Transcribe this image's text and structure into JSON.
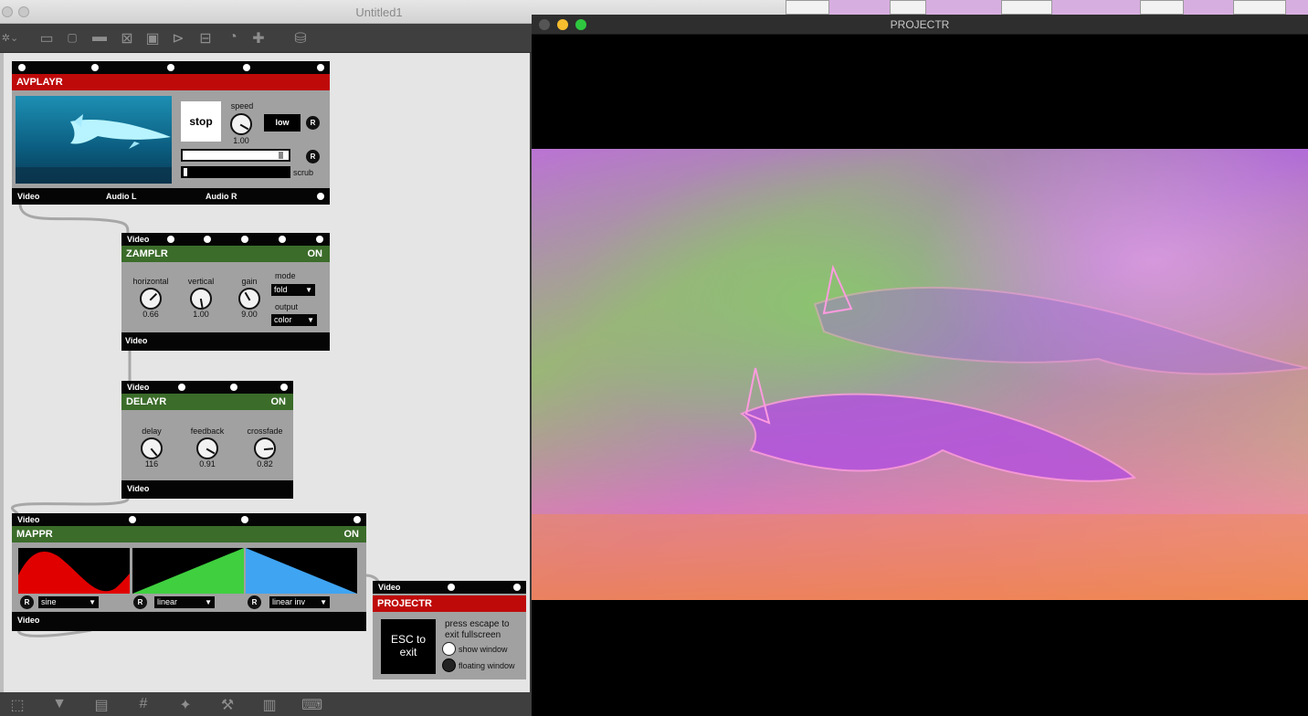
{
  "max_window": {
    "title": "Untitled1",
    "toolbar_icons": [
      "presentation-icon",
      "comment-icon",
      "message-icon",
      "toggle-icon",
      "number-icon",
      "play-icon",
      "slider-icon",
      "dial-icon",
      "add-icon",
      "paint-bucket-icon"
    ],
    "bottombar_icons": [
      "select-icon",
      "presentation-mode-icon",
      "layers-icon",
      "grid-icon",
      "snap-icon",
      "wrench-icon",
      "piano-icon",
      "keyboard-icon"
    ]
  },
  "avplayr": {
    "title": "AVPLAYR",
    "stop_label": "stop",
    "speed_label": "speed",
    "speed_value": "1.00",
    "quality_label": "low",
    "reset_label": "R",
    "scrub_label": "scrub",
    "outputs": [
      "Video",
      "Audio L",
      "Audio R"
    ]
  },
  "zamplr": {
    "input_label": "Video",
    "title": "ZAMPLR",
    "on_label": "ON",
    "knobs": [
      {
        "label": "horizontal",
        "value": "0.66"
      },
      {
        "label": "vertical",
        "value": "1.00"
      },
      {
        "label": "gain",
        "value": "9.00"
      }
    ],
    "mode_label": "mode",
    "mode_value": "fold",
    "output_label": "output",
    "output_value": "color",
    "output_port": "Video"
  },
  "delayr": {
    "input_label": "Video",
    "title": "DELAYR",
    "on_label": "ON",
    "knobs": [
      {
        "label": "delay",
        "value": "116"
      },
      {
        "label": "feedback",
        "value": "0.91"
      },
      {
        "label": "crossfade",
        "value": "0.82"
      }
    ],
    "output_port": "Video"
  },
  "mappr": {
    "input_label": "Video",
    "title": "MAPPR",
    "on_label": "ON",
    "curves": [
      {
        "name": "sine",
        "color": "#e10000"
      },
      {
        "name": "linear",
        "color": "#3fcf3f"
      },
      {
        "name": "linear inv",
        "color": "#3fa4f2"
      }
    ],
    "reset_label": "R",
    "output_port": "Video"
  },
  "projectr_module": {
    "input_label": "Video",
    "title": "PROJECTR",
    "esc_label_1": "ESC to",
    "esc_label_2": "exit",
    "hint_1": "press escape to",
    "hint_2": "exit fullscreen",
    "show_window_label": "show window",
    "floating_window_label": "floating window"
  },
  "projector_window": {
    "title": "PROJECTR"
  }
}
